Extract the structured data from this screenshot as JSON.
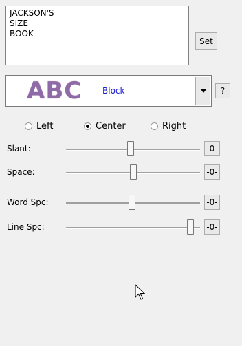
{
  "textbox": {
    "lines": [
      "JACKSON'S",
      "SIZE",
      "BOOK"
    ]
  },
  "set_button": {
    "label": "Set"
  },
  "font_selector": {
    "sample_text": "ABC",
    "font_name": "Block",
    "sample_color": "#8e6aa6",
    "name_color": "#1a1ad0"
  },
  "help_button": {
    "label": "?"
  },
  "alignment": {
    "options": [
      {
        "label": "Left",
        "selected": false
      },
      {
        "label": "Center",
        "selected": true
      },
      {
        "label": "Right",
        "selected": false
      }
    ]
  },
  "sliders": [
    {
      "label": "Slant:",
      "value_label": "-0-",
      "level": 0.5
    },
    {
      "label": "Space:",
      "value_label": "-0-",
      "level": 0.5
    },
    {
      "label": "Word Spc:",
      "value_label": "-0-",
      "level": 0.5
    },
    {
      "label": "Line Spc:",
      "value_label": "-0-",
      "level": 1.0
    }
  ]
}
